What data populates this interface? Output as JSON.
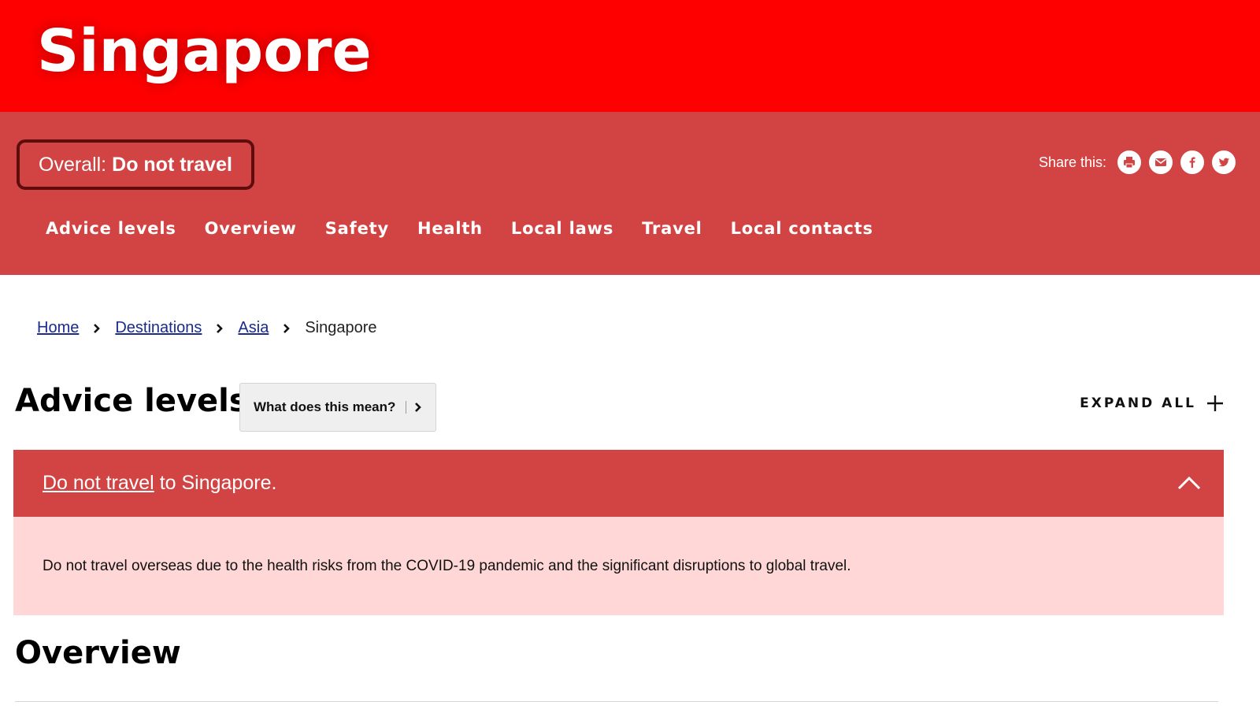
{
  "banner": {
    "title": "Singapore"
  },
  "overall": {
    "label": "Overall:",
    "value": "Do not travel"
  },
  "share": {
    "label": "Share this:",
    "icons": [
      "print-icon",
      "email-icon",
      "facebook-icon",
      "twitter-icon"
    ]
  },
  "nav": {
    "items": [
      {
        "label": "Advice levels"
      },
      {
        "label": "Overview"
      },
      {
        "label": "Safety"
      },
      {
        "label": "Health"
      },
      {
        "label": "Local laws"
      },
      {
        "label": "Travel"
      },
      {
        "label": "Local contacts"
      }
    ]
  },
  "breadcrumb": {
    "items": [
      {
        "label": "Home"
      },
      {
        "label": "Destinations"
      },
      {
        "label": "Asia"
      }
    ],
    "current": "Singapore"
  },
  "advice": {
    "title": "Advice levels",
    "what_button": "What does this mean?",
    "expand_all": "EXPAND ALL",
    "accordion": {
      "link": "Do not travel",
      "rest": " to Singapore.",
      "body": "Do not travel overseas due to the health risks from the COVID-19 pandemic and the significant disruptions to global travel."
    }
  },
  "overview": {
    "title": "Overview"
  },
  "colors": {
    "banner": "#ff0000",
    "subheader": "#d24444",
    "overall_border": "#5e0d0d",
    "accordion_body": "#ffd7d7",
    "link": "#1a2b8c"
  }
}
